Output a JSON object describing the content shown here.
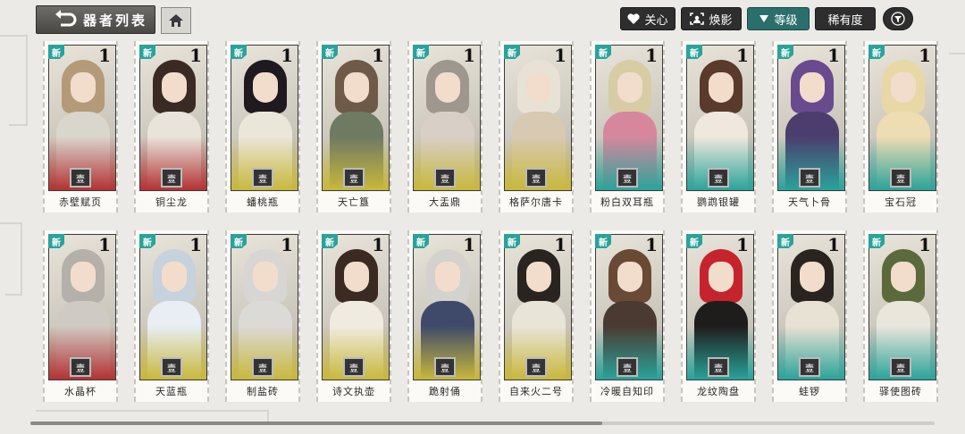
{
  "header": {
    "title": "器者列表",
    "buttons": {
      "care": "关心",
      "appearance": "焕影",
      "grade": "等级",
      "rarity": "稀有度"
    }
  },
  "colors": {
    "accent": "#2b6f6c",
    "new_badge": "#2aa39a"
  },
  "cards": [
    {
      "name": "赤壁赋页",
      "level": "1",
      "new": "新",
      "seal": "壹",
      "hair": "#b49a78",
      "body": "#d9d6ce",
      "tint": "#b33232"
    },
    {
      "name": "铜尘龙",
      "level": "1",
      "new": "新",
      "seal": "壹",
      "hair": "#3b2a24",
      "body": "#e8e4dc",
      "tint": "#b33232"
    },
    {
      "name": "蟠桃瓶",
      "level": "1",
      "new": "新",
      "seal": "壹",
      "hair": "#1e1a1f",
      "body": "#eae6d9",
      "tint": "#c8b83c"
    },
    {
      "name": "天亡簋",
      "level": "1",
      "new": "新",
      "seal": "壹",
      "hair": "#6e5a46",
      "body": "#6e7a62",
      "tint": "#c8b83c"
    },
    {
      "name": "大盂鼎",
      "level": "1",
      "new": "新",
      "seal": "壹",
      "hair": "#9e978d",
      "body": "#d8cfc6",
      "tint": "#c8b83c"
    },
    {
      "name": "格萨尔唐卡",
      "level": "1",
      "new": "新",
      "seal": "壹",
      "hair": "#e8e2d6",
      "body": "#d8c9b2",
      "tint": "#c8b83c"
    },
    {
      "name": "粉白双耳瓶",
      "level": "1",
      "new": "新",
      "seal": "壹",
      "hair": "#d7cca4",
      "body": "#d6879d",
      "tint": "#2aa39a"
    },
    {
      "name": "鹦鹉银罐",
      "level": "1",
      "new": "新",
      "seal": "壹",
      "hair": "#5a3a2a",
      "body": "#efe8de",
      "tint": "#2aa39a"
    },
    {
      "name": "天气卜骨",
      "level": "1",
      "new": "新",
      "seal": "壹",
      "hair": "#6a4a8e",
      "body": "#4b3e6e",
      "tint": "#2aa39a"
    },
    {
      "name": "宝石冠",
      "level": "1",
      "new": "新",
      "seal": "壹",
      "hair": "#e8d8a6",
      "body": "#eedcb2",
      "tint": "#2aa39a"
    },
    {
      "name": "水晶杯",
      "level": "1",
      "new": "新",
      "seal": "壹",
      "hair": "#b4b0aa",
      "body": "#cfcac3",
      "tint": "#b33232"
    },
    {
      "name": "天蓝瓶",
      "level": "1",
      "new": "新",
      "seal": "壹",
      "hair": "#c6d2dc",
      "body": "#e8eef3",
      "tint": "#c8b83c"
    },
    {
      "name": "制盐砖",
      "level": "1",
      "new": "新",
      "seal": "壹",
      "hair": "#d8d6d3",
      "body": "#dcdad6",
      "tint": "#c8b83c"
    },
    {
      "name": "诗文执壶",
      "level": "1",
      "new": "新",
      "seal": "壹",
      "hair": "#3a2a22",
      "body": "#f0ebe0",
      "tint": "#c8b83c"
    },
    {
      "name": "跪射俑",
      "level": "1",
      "new": "新",
      "seal": "壹",
      "hair": "#d4d2cf",
      "body": "#3f4a6b",
      "tint": "#c8b83c"
    },
    {
      "name": "自来火二号",
      "level": "1",
      "new": "新",
      "seal": "壹",
      "hair": "#2a2420",
      "body": "#e9e4d8",
      "tint": "#c8b83c"
    },
    {
      "name": "冷暖自知印",
      "level": "1",
      "new": "新",
      "seal": "壹",
      "hair": "#6a4a34",
      "body": "#4a3a32",
      "tint": "#2aa39a"
    },
    {
      "name": "龙纹陶盘",
      "level": "1",
      "new": "新",
      "seal": "壹",
      "hair": "#c6242c",
      "body": "#1f1c1c",
      "tint": "#2aa39a"
    },
    {
      "name": "蛙锣",
      "level": "1",
      "new": "新",
      "seal": "壹",
      "hair": "#2a2420",
      "body": "#e8e2d4",
      "tint": "#2aa39a"
    },
    {
      "name": "驿使图砖",
      "level": "1",
      "new": "新",
      "seal": "壹",
      "hair": "#5a6a3a",
      "body": "#eae6dc",
      "tint": "#2aa39a"
    }
  ]
}
